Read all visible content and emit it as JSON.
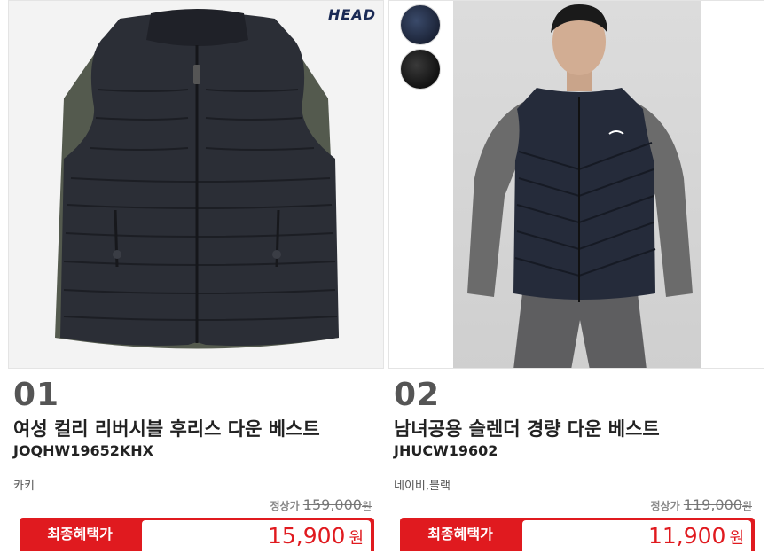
{
  "products": [
    {
      "number": "01",
      "name": "여성 컬리 리버시블 후리스 다운 베스트",
      "code": "JOQHW19652KHX",
      "color": "카키",
      "regular_label": "정상가",
      "regular_price": "159,000",
      "regular_unit": "원",
      "final_label": "최종혜택가",
      "final_price": "15,900",
      "final_unit": "원",
      "brand_logo": "HEAD",
      "image": "quilted-vest-photo"
    },
    {
      "number": "02",
      "name": "남녀공용 슬렌더 경량 다운 베스트",
      "code": "JHUCW19602",
      "color": "네이비,블랙",
      "regular_label": "정상가",
      "regular_price": "119,000",
      "regular_unit": "원",
      "final_label": "최종혜택가",
      "final_price": "11,900",
      "final_unit": "원",
      "swatches": [
        "#1c2438",
        "#111111"
      ],
      "image": "model-wearing-vest-photo"
    }
  ],
  "colors": {
    "accent": "#e01a1f",
    "brand": "#1a2a55"
  }
}
